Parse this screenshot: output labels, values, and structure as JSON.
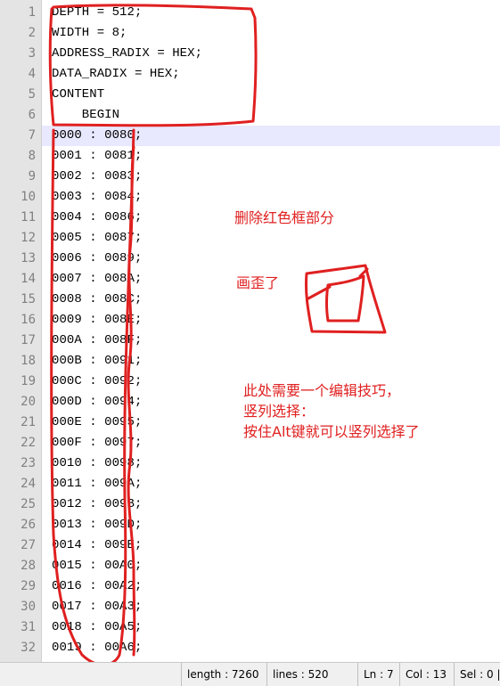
{
  "editor": {
    "lines": [
      {
        "num": "1",
        "text": "DEPTH = 512;"
      },
      {
        "num": "2",
        "text": "WIDTH = 8;"
      },
      {
        "num": "3",
        "text": "ADDRESS_RADIX = HEX;"
      },
      {
        "num": "4",
        "text": "DATA_RADIX = HEX;"
      },
      {
        "num": "5",
        "text": "CONTENT"
      },
      {
        "num": "6",
        "text": "    BEGIN"
      },
      {
        "num": "7",
        "text": "0000 : 0080;"
      },
      {
        "num": "8",
        "text": "0001 : 0081;"
      },
      {
        "num": "9",
        "text": "0002 : 0083;"
      },
      {
        "num": "10",
        "text": "0003 : 0084;"
      },
      {
        "num": "11",
        "text": "0004 : 0086;"
      },
      {
        "num": "12",
        "text": "0005 : 0087;"
      },
      {
        "num": "13",
        "text": "0006 : 0089;"
      },
      {
        "num": "14",
        "text": "0007 : 008A;"
      },
      {
        "num": "15",
        "text": "0008 : 008C;"
      },
      {
        "num": "16",
        "text": "0009 : 008E;"
      },
      {
        "num": "17",
        "text": "000A : 008F;"
      },
      {
        "num": "18",
        "text": "000B : 0091;"
      },
      {
        "num": "19",
        "text": "000C : 0092;"
      },
      {
        "num": "20",
        "text": "000D : 0094;"
      },
      {
        "num": "21",
        "text": "000E : 0095;"
      },
      {
        "num": "22",
        "text": "000F : 0097;"
      },
      {
        "num": "23",
        "text": "0010 : 0098;"
      },
      {
        "num": "24",
        "text": "0011 : 009A;"
      },
      {
        "num": "25",
        "text": "0012 : 009B;"
      },
      {
        "num": "26",
        "text": "0013 : 009D;"
      },
      {
        "num": "27",
        "text": "0014 : 009E;"
      },
      {
        "num": "28",
        "text": "0015 : 00A0;"
      },
      {
        "num": "29",
        "text": "0016 : 00A2;"
      },
      {
        "num": "30",
        "text": "0017 : 00A3;"
      },
      {
        "num": "31",
        "text": "0018 : 00A5;"
      },
      {
        "num": "32",
        "text": "0019 : 00A6;"
      }
    ],
    "current_line": 7
  },
  "annotations": {
    "note1": "删除红色框部分",
    "note2": "画歪了",
    "note3_line1": "此处需要一个编辑技巧，",
    "note3_line2": "竖列选择：",
    "note3_line3": "按住Alt键就可以竖列选择了",
    "ink_color": "#e02020"
  },
  "statusbar": {
    "length": "length : 7260",
    "lines": "lines : 520",
    "ln": "Ln : 7",
    "col": "Col : 13",
    "sel": "Sel : 0 |"
  }
}
